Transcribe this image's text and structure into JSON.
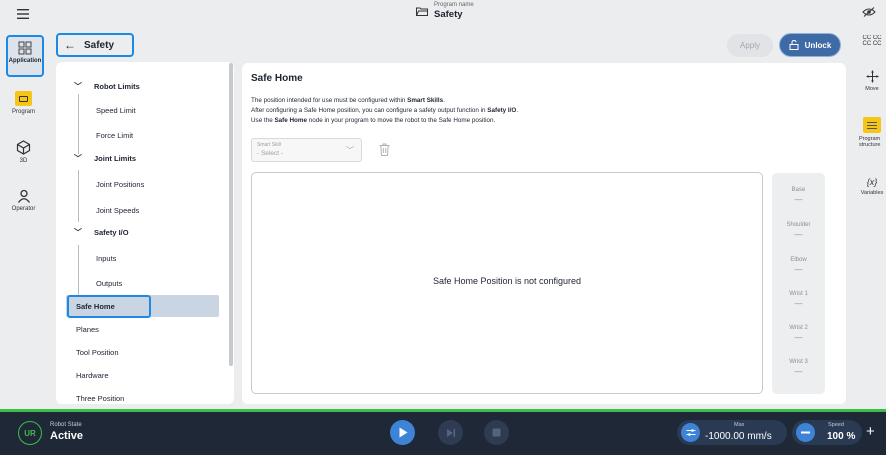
{
  "topbar": {
    "program_caption": "Program name",
    "program_name": "Safety",
    "menu_icon": "hamburger-menu-icon",
    "top_right_icon": "eye-off-icon"
  },
  "left_rail": {
    "items": [
      {
        "label": "Application",
        "icon": "application-grid-icon",
        "active": true
      },
      {
        "label": "Program",
        "icon": "program-icon"
      },
      {
        "label": "3D",
        "icon": "cube-3d-icon"
      },
      {
        "label": "Operator",
        "icon": "person-icon"
      }
    ]
  },
  "right_rail": {
    "items": [
      {
        "label": "CC CC\nCC CC",
        "icon": "cc-icon"
      },
      {
        "label": "Move",
        "icon": "move-arrows-icon"
      },
      {
        "label": "Program structure",
        "icon": "program-structure-icon"
      },
      {
        "label": "Variables",
        "icon": "variables-icon",
        "glyph": "{x}"
      }
    ]
  },
  "header": {
    "back_label": "Safety",
    "apply_label": "Apply",
    "unlock_label": "Unlock"
  },
  "nav": {
    "robot_limits": "Robot Limits",
    "speed_limit": "Speed Limit",
    "force_limit": "Force Limit",
    "joint_limits": "Joint Limits",
    "joint_positions": "Joint Positions",
    "joint_speeds": "Joint Speeds",
    "safety_io": "Safety I/O",
    "inputs": "Inputs",
    "outputs": "Outputs",
    "safe_home": "Safe Home",
    "planes": "Planes",
    "tool_position": "Tool Position",
    "hardware": "Hardware",
    "three_position": "Three Position"
  },
  "main": {
    "title": "Safe Home",
    "desc_line1_a": "The position intended for use must be configured within ",
    "desc_line1_b": "Smart Skills",
    "desc_line1_c": ".",
    "desc_line2_a": "After configuring a Safe Home position, you can configure a safety output function in ",
    "desc_line2_b": "Safety I/O",
    "desc_line2_c": ".",
    "desc_line3_a": "Use the ",
    "desc_line3_b": "Safe Home",
    "desc_line3_c": " node in your program to move the robot to the Safe Home position.",
    "skill_label": "Smart Skill",
    "skill_value": "- Select -",
    "not_configured": "Safe Home Position is not configured",
    "joints": [
      {
        "name": "Base",
        "value": "—"
      },
      {
        "name": "Shoulder",
        "value": "—"
      },
      {
        "name": "Elbow",
        "value": "—"
      },
      {
        "name": "Wrist 1",
        "value": "—"
      },
      {
        "name": "Wrist 2",
        "value": "—"
      },
      {
        "name": "Wrist 3",
        "value": "—"
      }
    ]
  },
  "bottombar": {
    "logo_text": "UR",
    "robot_state_caption": "Robot State",
    "robot_state_value": "Active",
    "max_caption": "Max",
    "max_value": "-1000.00 mm/s",
    "speed_caption": "Speed",
    "speed_value": "100 %",
    "plus_label": "+"
  },
  "colors": {
    "accent": "#1e88e5",
    "unlock": "#3e6aa6",
    "bottom_bar": "#1f2837",
    "active_green": "#3dbd4a",
    "program_yellow": "#f5c518"
  }
}
